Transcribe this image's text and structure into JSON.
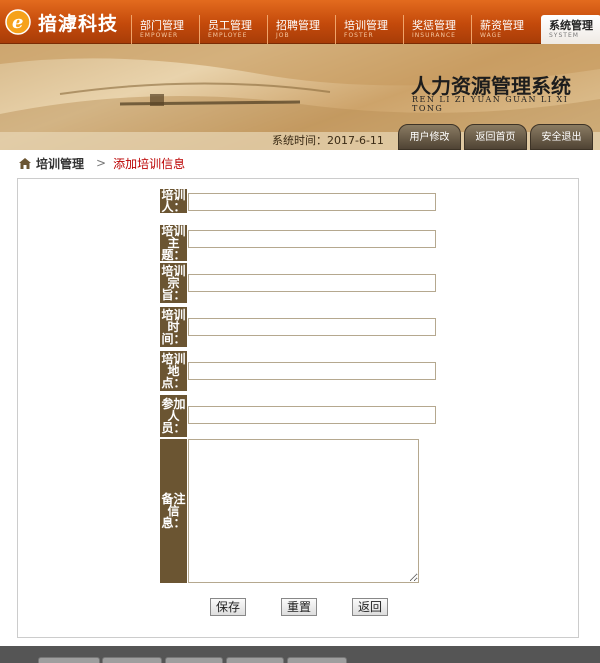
{
  "brand": {
    "logo_letter": "e",
    "name": "揞滹科技"
  },
  "nav": [
    {
      "label": "部门管理",
      "sub": "EMPOWER"
    },
    {
      "label": "员工管理",
      "sub": "EMPLOYEE"
    },
    {
      "label": "招聘管理",
      "sub": "JOB"
    },
    {
      "label": "培训管理",
      "sub": "FOSTER"
    },
    {
      "label": "奖惩管理",
      "sub": "INSURANCE"
    },
    {
      "label": "薪资管理",
      "sub": "WAGE"
    },
    {
      "label": "系统管理",
      "sub": "SYSTEM"
    }
  ],
  "banner": {
    "title": "人力资源管理系统",
    "subtitle": "REN LI ZI YUAN GUAN LI XI TONG",
    "time_text": "系统时间：2017-6-11",
    "buttons": {
      "user_info": "用户修改",
      "back_home": "返回首页",
      "logout": "安全退出"
    }
  },
  "breadcrumb": {
    "section": "培训管理",
    "page": "添加培训信息"
  },
  "form": {
    "fields": [
      {
        "label": "培训人：",
        "value": ""
      },
      {
        "label": "培训主题：",
        "value": ""
      },
      {
        "label": "培训宗旨：",
        "value": ""
      },
      {
        "label": "培训时间：",
        "value": ""
      },
      {
        "label": "培训地点：",
        "value": ""
      },
      {
        "label": "参加人员：",
        "value": ""
      }
    ],
    "notes_label": "备注信息：",
    "notes_value": "",
    "save": "保存",
    "reset": "重置",
    "back": "返回"
  },
  "colors": {
    "accent": "#c44a0b",
    "label_bg": "#6b5532",
    "breadcrumb_link": "#bb0000"
  }
}
